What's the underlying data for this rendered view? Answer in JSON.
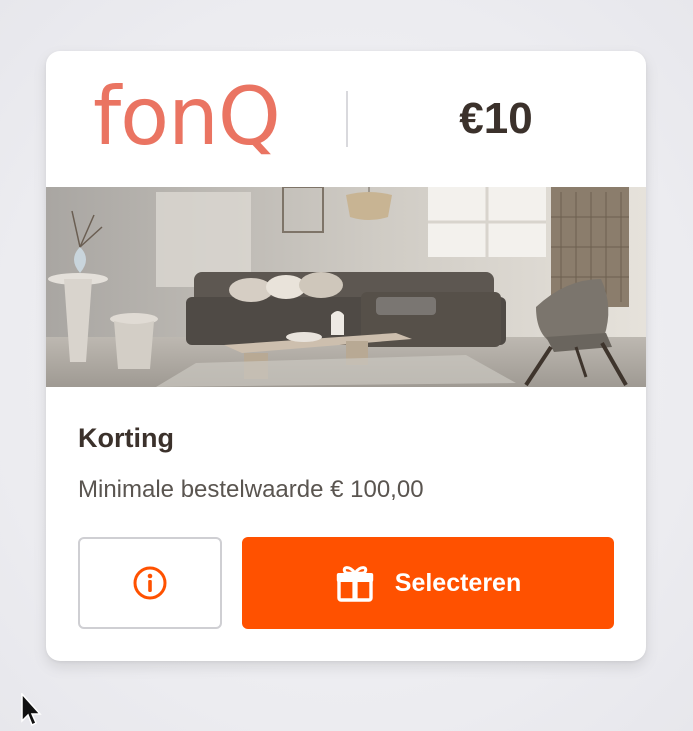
{
  "card": {
    "brand": "fonQ",
    "value": "€10",
    "title": "Korting",
    "condition": "Minimale bestelwaarde € 100,00",
    "select_label": "Selecteren"
  },
  "colors": {
    "brand": "#ea7462",
    "accent": "#ff5100",
    "text_dark": "#3b312b",
    "text_muted": "#5a5550"
  },
  "icons": {
    "info": "info-circle-icon",
    "select": "gift-icon"
  }
}
